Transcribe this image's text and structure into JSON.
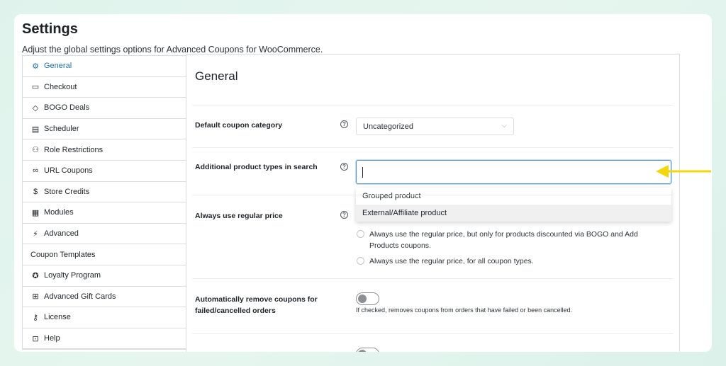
{
  "header": {
    "title": "Settings",
    "description": "Adjust the global settings options for Advanced Coupons for WooCommerce."
  },
  "sidebar": {
    "items": [
      {
        "label": "General",
        "icon": "gear-icon",
        "glyph": "⚙",
        "active": true
      },
      {
        "label": "Checkout",
        "icon": "card-icon",
        "glyph": "▭"
      },
      {
        "label": "BOGO Deals",
        "icon": "tag-icon",
        "glyph": "◇"
      },
      {
        "label": "Scheduler",
        "icon": "calendar-icon",
        "glyph": "▤"
      },
      {
        "label": "Role Restrictions",
        "icon": "user-icon",
        "glyph": "⚇"
      },
      {
        "label": "URL Coupons",
        "icon": "link-icon",
        "glyph": "∞"
      },
      {
        "label": "Store Credits",
        "icon": "coin-icon",
        "glyph": "$"
      },
      {
        "label": "Modules",
        "icon": "modules-icon",
        "glyph": "▦"
      },
      {
        "label": "Advanced",
        "icon": "bolt-icon",
        "glyph": "⚡"
      },
      {
        "label": "Coupon Templates",
        "icon": "",
        "glyph": ""
      },
      {
        "label": "Loyalty Program",
        "icon": "award-icon",
        "glyph": "✪"
      },
      {
        "label": "Advanced Gift Cards",
        "icon": "gift-icon",
        "glyph": "⊞"
      },
      {
        "label": "License",
        "icon": "key-icon",
        "glyph": "⚷"
      },
      {
        "label": "Help",
        "icon": "lifebuoy-icon",
        "glyph": "⊡"
      }
    ]
  },
  "main": {
    "section_title": "General",
    "default_category": {
      "label": "Default coupon category",
      "value": "Uncategorized"
    },
    "additional_types": {
      "label": "Additional product types in search",
      "value": "",
      "options": [
        "Grouped product",
        "External/Affiliate product"
      ]
    },
    "regular_price": {
      "label": "Always use regular price",
      "options": [
        "Always use the regular price, but only for products discounted via BOGO and Add Products coupons.",
        "Always use the regular price, for all coupon types."
      ]
    },
    "auto_remove": {
      "label": "Automatically remove coupons for failed/cancelled orders",
      "description": "If checked, removes coupons from orders that have failed or been cancelled."
    }
  },
  "colors": {
    "accent": "#2271b1",
    "arrow": "#f5d60a"
  }
}
